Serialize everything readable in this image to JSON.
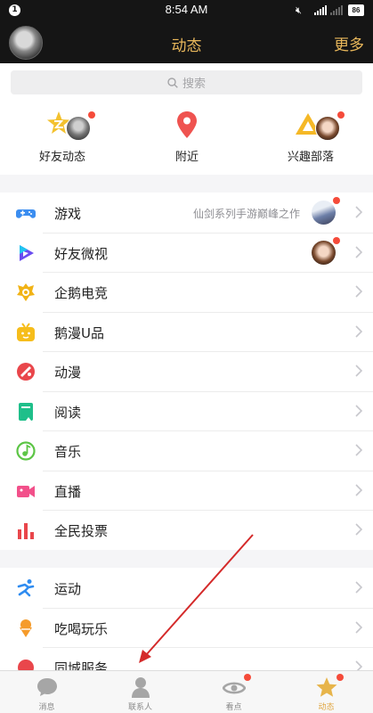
{
  "status_bar": {
    "notification_badge": "1",
    "time": "8:54 AM",
    "battery": "86"
  },
  "header": {
    "title": "动态",
    "more_label": "更多"
  },
  "search": {
    "placeholder": "搜索",
    "icon": "search-icon"
  },
  "quick_entries": [
    {
      "label": "好友动态",
      "icon": "star-icon"
    },
    {
      "label": "附近",
      "icon": "location-pin-icon"
    },
    {
      "label": "兴趣部落",
      "icon": "triangle-tribe-icon"
    }
  ],
  "list_main": [
    {
      "label": "游戏",
      "subtitle": "仙剑系列手游巅峰之作",
      "icon": "gamepad-icon",
      "color": "#3b8df0"
    },
    {
      "label": "好友微视",
      "icon": "weishi-icon",
      "color": "#6a4cf0"
    },
    {
      "label": "企鹅电竞",
      "icon": "esports-icon",
      "color": "#f1b316"
    },
    {
      "label": "鹅漫U品",
      "icon": "tv-box-icon",
      "color": "#f6bd1b"
    },
    {
      "label": "动漫",
      "icon": "comic-icon",
      "color": "#e9464b"
    },
    {
      "label": "阅读",
      "icon": "book-icon",
      "color": "#1fbf8a"
    },
    {
      "label": "音乐",
      "icon": "music-icon",
      "color": "#5cc545"
    },
    {
      "label": "直播",
      "icon": "live-camera-icon",
      "color": "#f2508a"
    },
    {
      "label": "全民投票",
      "icon": "vote-bars-icon",
      "color": "#e9464b"
    }
  ],
  "list_secondary": [
    {
      "label": "运动",
      "icon": "sport-runner-icon",
      "color": "#2f8cf0"
    },
    {
      "label": "吃喝玩乐",
      "icon": "icecream-icon",
      "color": "#f59b2b"
    },
    {
      "label": "同城服务",
      "icon": "city-service-icon",
      "color": "#e9464b"
    }
  ],
  "tabbar": [
    {
      "label": "消息",
      "icon": "message-icon"
    },
    {
      "label": "联系人",
      "icon": "contacts-icon"
    },
    {
      "label": "看点",
      "icon": "kandian-eye-icon"
    },
    {
      "label": "动态",
      "icon": "star-tab-icon",
      "active": true
    }
  ],
  "colors": {
    "header_bg": "#151515",
    "accent": "#e8b75b",
    "red_dot": "#f54b3a",
    "annotation_arrow": "#d42a2a"
  }
}
